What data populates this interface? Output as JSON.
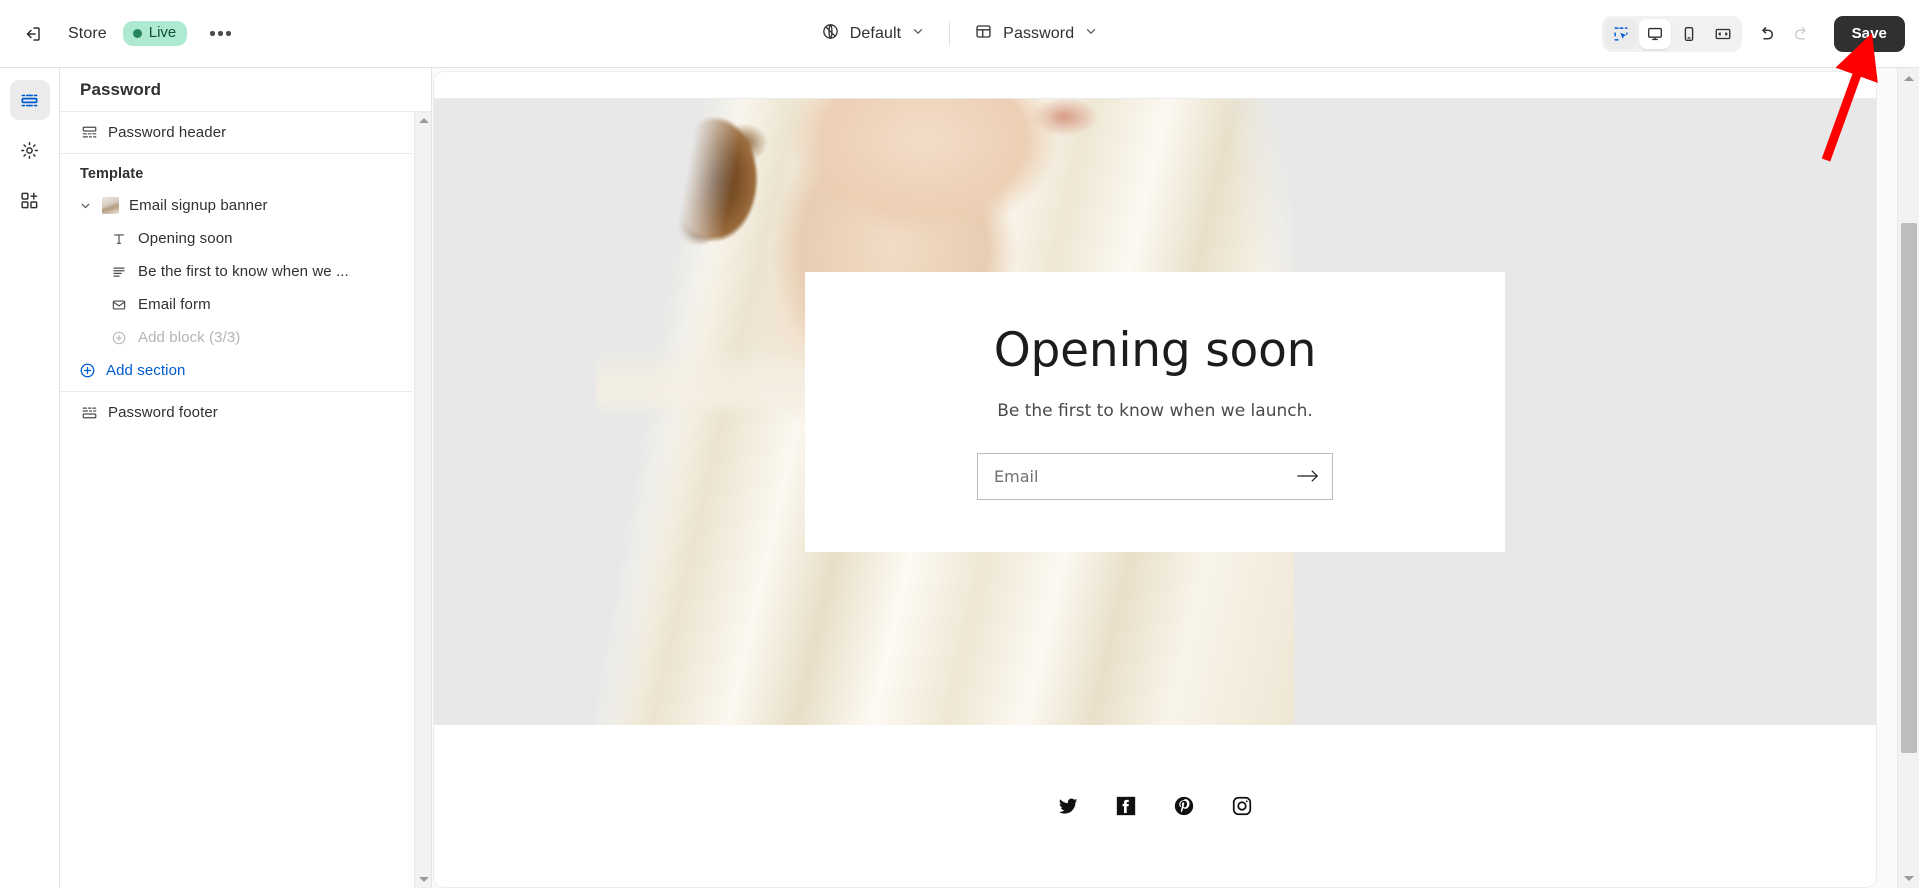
{
  "topbar": {
    "exit_label": "exit-to-app",
    "store_name": "Store",
    "status_badge": "Live",
    "more_label": "...",
    "theme_selector": {
      "label": "Default",
      "icon": "globe-icon"
    },
    "template_selector": {
      "label": "Password",
      "icon": "template-icon"
    },
    "viewport": {
      "inspector_label": "Inspector",
      "desktop_label": "Desktop",
      "mobile_label": "Mobile",
      "fullscreen_label": "Full screen"
    },
    "undo_label": "Undo",
    "redo_label": "Redo",
    "save_label": "Save",
    "accent_blue": "#005bd3",
    "save_bg": "#303030",
    "badge_bg": "#aee9d1",
    "badge_fg": "#0c5132"
  },
  "rail": {
    "items": [
      {
        "name": "sections",
        "label": "Sections",
        "active": true
      },
      {
        "name": "settings",
        "label": "Theme settings",
        "active": false
      },
      {
        "name": "apps",
        "label": "App embeds",
        "active": false
      }
    ]
  },
  "panel": {
    "title": "Password",
    "header_group": [
      {
        "label": "Password header",
        "icon": "header-icon"
      }
    ],
    "template_label": "Template",
    "section": {
      "label": "Email signup banner",
      "icon": "image-thumbnail",
      "expanded": true,
      "blocks": [
        {
          "label": "Opening soon",
          "icon": "text-icon"
        },
        {
          "label": "Be the first to know when we ...",
          "icon": "paragraph-icon"
        },
        {
          "label": "Email form",
          "icon": "email-icon"
        }
      ],
      "add_block_label": "Add block (3/3)",
      "add_block_disabled": true
    },
    "add_section_label": "Add section",
    "footer_group": [
      {
        "label": "Password footer",
        "icon": "footer-icon"
      }
    ]
  },
  "preview": {
    "heading": "Opening soon",
    "subheading": "Be the first to know when we launch.",
    "email_placeholder": "Email",
    "email_value": "",
    "submit_label": "Subscribe",
    "social": [
      {
        "name": "twitter",
        "label": "Twitter"
      },
      {
        "name": "facebook",
        "label": "Facebook"
      },
      {
        "name": "pinterest",
        "label": "Pinterest"
      },
      {
        "name": "instagram",
        "label": "Instagram"
      }
    ]
  },
  "annotation": {
    "color": "#ff0000",
    "points_at": "save-button"
  }
}
